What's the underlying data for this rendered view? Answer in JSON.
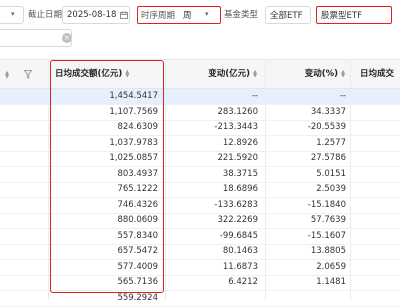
{
  "filters": {
    "date_label": "截止日期",
    "date_value": "2025-08-18",
    "period_label": "时序周期",
    "period_value": "周",
    "fund_type_label": "基金类型",
    "fund_type_value": "全部ETF",
    "sub_type_value": "股票型ETF"
  },
  "table": {
    "headers": [
      "日均成交额(亿元)",
      "变动(亿元)",
      "变动(%)",
      "日均成交"
    ],
    "rows": [
      [
        "1,454.5417",
        "--",
        "--"
      ],
      [
        "1,107.7569",
        "283.1260",
        "34.3337"
      ],
      [
        "824.6309",
        "-213.3443",
        "-20.5539"
      ],
      [
        "1,037.9783",
        "12.8926",
        "1.2577"
      ],
      [
        "1,025.0857",
        "221.5920",
        "27.5786"
      ],
      [
        "803.4937",
        "38.3715",
        "5.0151"
      ],
      [
        "765.1222",
        "18.6896",
        "2.5039"
      ],
      [
        "746.4326",
        "-133.6283",
        "-15.1840"
      ],
      [
        "880.0609",
        "322.2269",
        "57.7639"
      ],
      [
        "557.8340",
        "-99.6845",
        "-15.1607"
      ],
      [
        "657.5472",
        "80.1463",
        "13.8805"
      ],
      [
        "577.4009",
        "11.6873",
        "2.0659"
      ],
      [
        "565.7136",
        "6.4212",
        "1.1481"
      ],
      [
        "559.2924",
        "",
        ""
      ]
    ]
  }
}
